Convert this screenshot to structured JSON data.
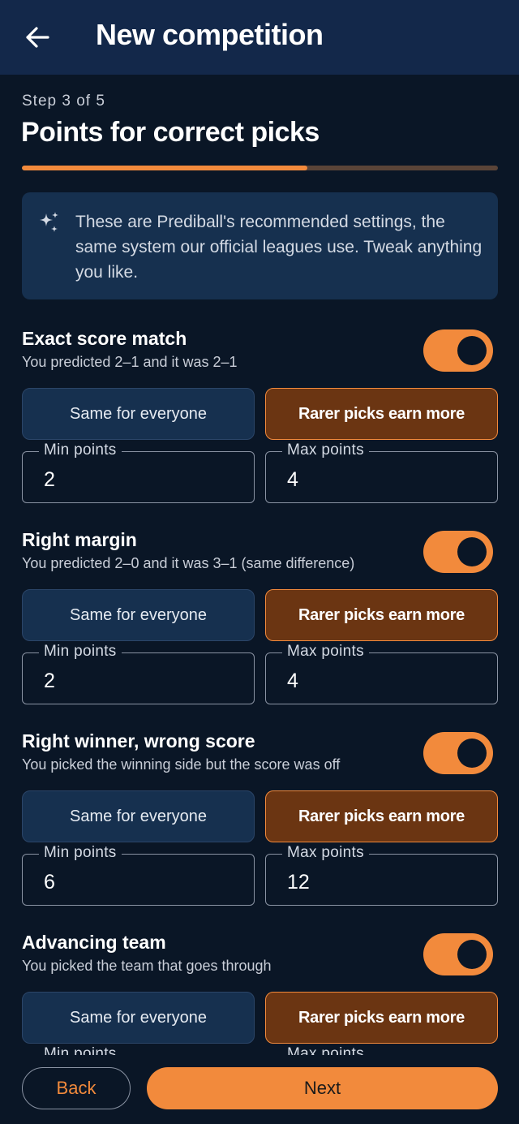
{
  "header": {
    "title": "New competition",
    "back_icon": "arrow-left-icon"
  },
  "step": {
    "label": "Step 3 of 5",
    "title": "Points for correct picks",
    "current": 3,
    "total": 5,
    "progress_fraction": 0.6
  },
  "info": {
    "icon": "sparkle-icon",
    "text": "These are Prediball's recommended settings, the same system our official leagues use. Tweak anything you like."
  },
  "sections": [
    {
      "title": "Exact score match",
      "subtitle": "You predicted 2–1 and it was 2–1",
      "enabled": true,
      "option_same": "Same for everyone",
      "option_rarer": "Rarer picks earn more",
      "selected": "rarer",
      "min_label": "Min points",
      "min_value": "2",
      "max_label": "Max points",
      "max_value": "4"
    },
    {
      "title": "Right margin",
      "subtitle": "You predicted 2–0 and it was 3–1 (same difference)",
      "enabled": true,
      "option_same": "Same for everyone",
      "option_rarer": "Rarer picks earn more",
      "selected": "rarer",
      "min_label": "Min points",
      "min_value": "2",
      "max_label": "Max points",
      "max_value": "4"
    },
    {
      "title": "Right winner, wrong score",
      "subtitle": "You picked the winning side but the score was off",
      "enabled": true,
      "option_same": "Same for everyone",
      "option_rarer": "Rarer picks earn more",
      "selected": "rarer",
      "min_label": "Min points",
      "min_value": "6",
      "max_label": "Max points",
      "max_value": "12"
    },
    {
      "title": "Advancing team",
      "subtitle": "You picked the team that goes through",
      "enabled": true,
      "option_same": "Same for everyone",
      "option_rarer": "Rarer picks earn more",
      "selected": "rarer",
      "min_label": "Min points",
      "min_value": "",
      "max_label": "Max points",
      "max_value": ""
    }
  ],
  "footer": {
    "back_label": "Back",
    "next_label": "Next"
  },
  "colors": {
    "background": "#0a1626",
    "app_bar": "#13284a",
    "accent": "#f28a3c",
    "selected_segment": "#6b3512",
    "card": "#16304f"
  }
}
